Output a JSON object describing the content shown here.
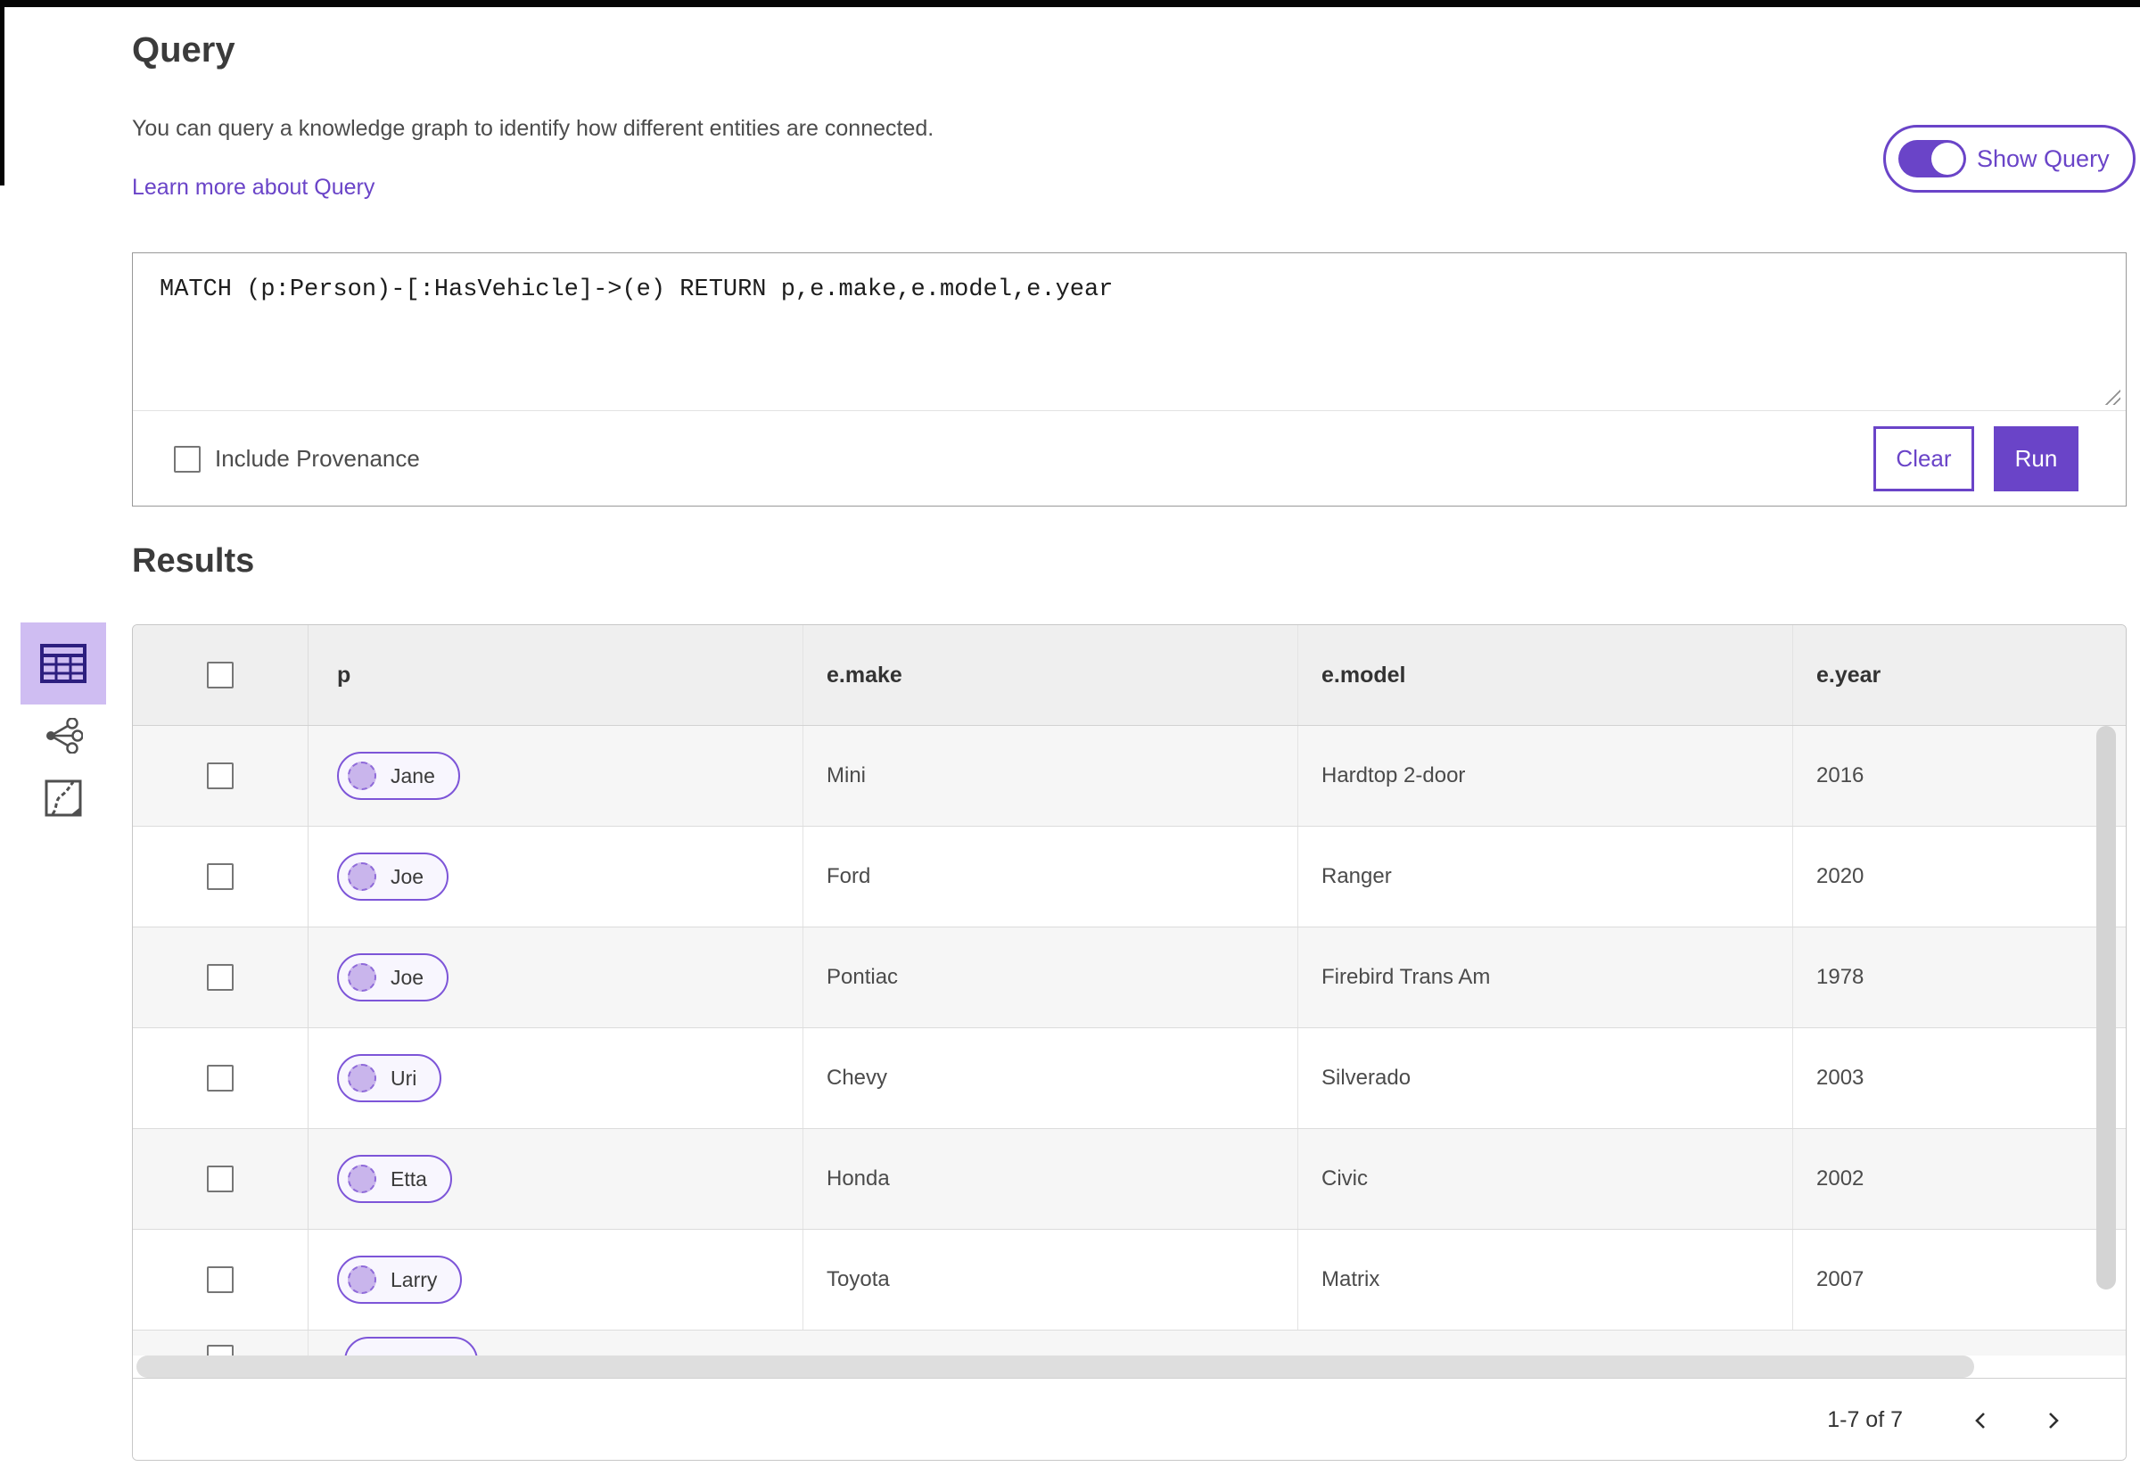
{
  "query_section": {
    "title": "Query",
    "description": "You can query a knowledge graph to identify how different entities are connected.",
    "learn_more_link": "Learn more about Query",
    "show_query_toggle": {
      "label": "Show Query",
      "state": "on"
    },
    "query_input": {
      "value": "MATCH (p:Person)-[:HasVehicle]->(e) RETURN p,e.make,e.model,e.year"
    },
    "include_provenance": {
      "label": "Include Provenance",
      "checked": false
    },
    "clear_button": "Clear",
    "run_button": "Run"
  },
  "results_section": {
    "title": "Results",
    "view_toolbar": [
      {
        "name": "table-view",
        "icon": "table-icon",
        "selected": true
      },
      {
        "name": "link-chart-view",
        "icon": "link-chart-icon",
        "selected": false
      },
      {
        "name": "map-view",
        "icon": "map-icon",
        "selected": false
      }
    ]
  },
  "results_table": {
    "columns": [
      "p",
      "e.make",
      "e.model",
      "e.year"
    ],
    "rows": [
      {
        "p": "Jane",
        "make": "Mini",
        "model": "Hardtop 2-door",
        "year": "2016"
      },
      {
        "p": "Joe",
        "make": "Ford",
        "model": "Ranger",
        "year": "2020"
      },
      {
        "p": "Joe",
        "make": "Pontiac",
        "model": "Firebird Trans Am",
        "year": "1978"
      },
      {
        "p": "Uri",
        "make": "Chevy",
        "model": "Silverado",
        "year": "2003"
      },
      {
        "p": "Etta",
        "make": "Honda",
        "model": "Civic",
        "year": "2002"
      },
      {
        "p": "Larry",
        "make": "Toyota",
        "model": "Matrix",
        "year": "2007"
      }
    ],
    "partial_row_visible": true
  },
  "pagination": {
    "range_label": "1-7 of 7",
    "prev_icon": "chevron-left",
    "next_icon": "chevron-right"
  },
  "colors": {
    "accent_purple": "#6a44c8",
    "entity_pill_border": "#7d55d8",
    "entity_dot_fill": "#c9b5ec",
    "selected_tile_bg": "#cfbdf2",
    "header_bg": "#efefef",
    "stripe_bg": "#f6f6f6"
  }
}
